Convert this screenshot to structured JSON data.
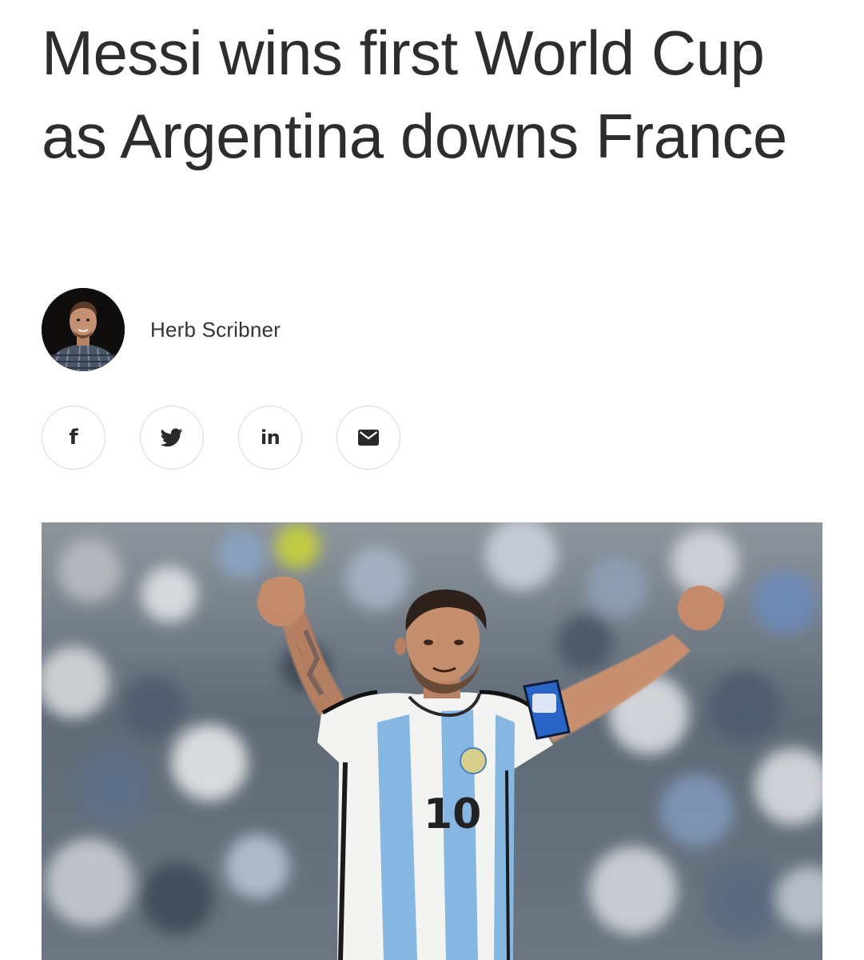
{
  "article": {
    "headline": "Messi wins first World Cup as Argentina downs France",
    "author": {
      "name": "Herb Scribner",
      "avatar_icon": "author-portrait"
    },
    "share": [
      {
        "name": "facebook",
        "label": "f",
        "icon": "facebook-icon"
      },
      {
        "name": "twitter",
        "label": "",
        "icon": "twitter-bird-icon"
      },
      {
        "name": "linkedin",
        "label": "in",
        "icon": "linkedin-icon"
      },
      {
        "name": "email",
        "label": "",
        "icon": "envelope-icon"
      }
    ],
    "hero_image": {
      "jersey_number": "10",
      "colors": {
        "sky_blue": "#7fb6e6",
        "white": "#f4f4f4",
        "armband": "#2a66c8"
      }
    }
  },
  "theme": {
    "text": "#2d2d2d",
    "border": "#d9d9d9",
    "background": "#ffffff"
  }
}
